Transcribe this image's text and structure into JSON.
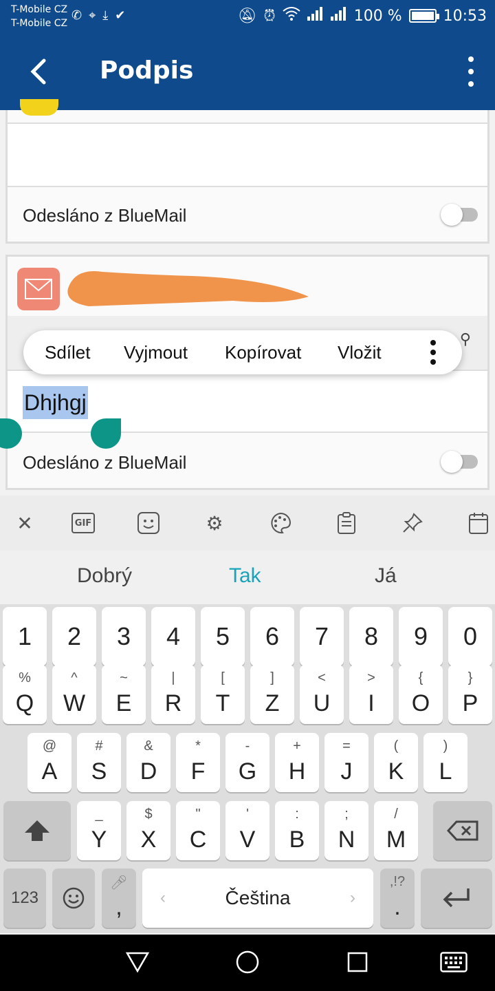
{
  "status_bar": {
    "carrier1": "T-Mobile CZ",
    "carrier2": "T-Mobile CZ",
    "battery": "100 %",
    "battery_level": 100,
    "time": "10:53"
  },
  "app_bar": {
    "title": "Podpis",
    "back_icon": "arrow-back-icon",
    "menu_icon": "more-vert-icon"
  },
  "accounts": [
    {
      "signature_text": "",
      "sent_from_label": "Odesláno z BlueMail",
      "toggle_on": false
    },
    {
      "signature_text": "Dhjhgj",
      "sent_from_label": "Odesláno z BlueMail",
      "toggle_on": false
    }
  ],
  "context_menu": {
    "share": "Sdílet",
    "cut": "Vyjmout",
    "copy": "Kopírovat",
    "paste": "Vložit"
  },
  "keyboard": {
    "suggestions": [
      "Dobrý",
      "Tak",
      "Já"
    ],
    "toolbar_icons": [
      "close-icon",
      "gif-icon",
      "sticker-icon",
      "settings-icon",
      "theme-icon",
      "clipboard-icon",
      "pin-icon",
      "calendar-icon"
    ],
    "number_row": [
      "1",
      "2",
      "3",
      "4",
      "5",
      "6",
      "7",
      "8",
      "9",
      "0"
    ],
    "row1": [
      {
        "k": "Q",
        "s": "%"
      },
      {
        "k": "W",
        "s": "^"
      },
      {
        "k": "E",
        "s": "~"
      },
      {
        "k": "R",
        "s": "|"
      },
      {
        "k": "T",
        "s": "["
      },
      {
        "k": "Z",
        "s": "]"
      },
      {
        "k": "U",
        "s": "<"
      },
      {
        "k": "I",
        "s": ">"
      },
      {
        "k": "O",
        "s": "{"
      },
      {
        "k": "P",
        "s": "}"
      }
    ],
    "row2": [
      {
        "k": "A",
        "s": "@"
      },
      {
        "k": "S",
        "s": "#"
      },
      {
        "k": "D",
        "s": "&"
      },
      {
        "k": "F",
        "s": "*"
      },
      {
        "k": "G",
        "s": "-"
      },
      {
        "k": "H",
        "s": "+"
      },
      {
        "k": "J",
        "s": "="
      },
      {
        "k": "K",
        "s": "("
      },
      {
        "k": "L",
        "s": ")"
      }
    ],
    "row3": [
      {
        "k": "Y",
        "s": "_"
      },
      {
        "k": "X",
        "s": "$"
      },
      {
        "k": "C",
        "s": "\""
      },
      {
        "k": "V",
        "s": "'"
      },
      {
        "k": "B",
        "s": ":"
      },
      {
        "k": "N",
        "s": ";"
      },
      {
        "k": "M",
        "s": "/"
      }
    ],
    "symbols_key": "123",
    "comma_key": ",",
    "period_key": ".",
    "period_sub": ",!?",
    "space_label": "Čeština",
    "space_left": "‹",
    "space_right": "›"
  },
  "nav_bar": {
    "back": "nav-back-icon",
    "home": "nav-home-icon",
    "recents": "nav-recents-icon",
    "keyboard": "keyboard-icon"
  }
}
